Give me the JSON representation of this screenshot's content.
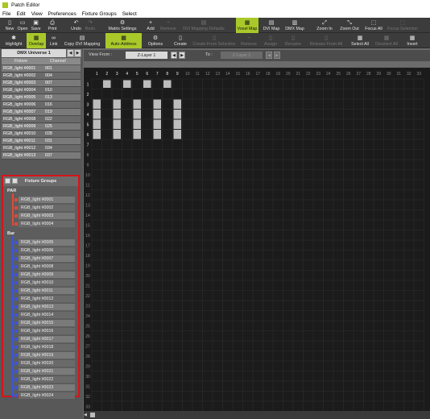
{
  "window": {
    "title": "Patch Editor"
  },
  "menu": [
    "File",
    "Edit",
    "View",
    "Preferences",
    "Fixture Groups",
    "Select"
  ],
  "toolbar1": [
    {
      "label": "New",
      "icon": "▯"
    },
    {
      "label": "Open",
      "icon": "▭"
    },
    {
      "label": "Save",
      "icon": "▣"
    },
    {
      "label": "Print",
      "icon": "⎙"
    },
    {
      "label": "Undo",
      "icon": "↶"
    },
    {
      "label": "Redo",
      "icon": "↷"
    },
    {
      "label": "Matrix Settings",
      "icon": "⚙"
    },
    {
      "label": "Add",
      "icon": "+"
    },
    {
      "label": "Remove",
      "icon": "−"
    },
    {
      "label": "DVI Mapping Defaults",
      "icon": "▤"
    },
    {
      "label": "Voxel Map",
      "icon": "▦"
    },
    {
      "label": "DVI Map",
      "icon": "▤"
    },
    {
      "label": "DMX Map",
      "icon": "▥"
    },
    {
      "label": "Zoom In",
      "icon": "⤢"
    },
    {
      "label": "Zoom Out",
      "icon": "⤡"
    },
    {
      "label": "Focus All",
      "icon": "⬚"
    },
    {
      "label": "Focus Selection",
      "icon": "⬚"
    }
  ],
  "toolbar2": [
    {
      "label": "Highlight",
      "icon": "✱"
    },
    {
      "label": "Overlap",
      "icon": "▦"
    },
    {
      "label": "Link",
      "icon": "∞"
    },
    {
      "label": "Copy DVI Mapping",
      "icon": "▤"
    },
    {
      "label": "Auto-Address",
      "icon": "▦"
    },
    {
      "label": "Options",
      "icon": "⚙"
    },
    {
      "label": "Create",
      "icon": "▯"
    },
    {
      "label": "Create From Selection",
      "icon": "▯"
    },
    {
      "label": "Remove",
      "icon": "−"
    },
    {
      "label": "Assign",
      "icon": "▯"
    },
    {
      "label": "Rename",
      "icon": "▯"
    },
    {
      "label": "Release From All",
      "icon": "▯"
    },
    {
      "label": "Select All",
      "icon": "▦"
    },
    {
      "label": "Deselect All",
      "icon": "▦"
    },
    {
      "label": "Invert",
      "icon": "▦"
    }
  ],
  "universe": {
    "label": "DMX Universe 1"
  },
  "patch_table": {
    "headers": [
      "Fixture",
      "Channel"
    ],
    "rows": [
      [
        "RGB_light #0001",
        "001"
      ],
      [
        "RGB_light #0002",
        "004"
      ],
      [
        "RGB_light #0003",
        "007"
      ],
      [
        "RGB_light #0004",
        "010"
      ],
      [
        "RGB_light #0005",
        "013"
      ],
      [
        "RGB_light #0006",
        "016"
      ],
      [
        "RGB_light #0007",
        "019"
      ],
      [
        "RGB_light #0008",
        "022"
      ],
      [
        "RGB_light #0009",
        "025"
      ],
      [
        "RGB_light #0010",
        "028"
      ],
      [
        "RGB_light #0011",
        "031"
      ],
      [
        "RGB_light #0012",
        "034"
      ],
      [
        "RGB_light #0013",
        "037"
      ]
    ]
  },
  "fixture_groups": {
    "header": "Fixture Groups",
    "groups": [
      {
        "name": "PAR",
        "color": "#e04a3a",
        "items": [
          "RGB_light #0001",
          "RGB_light #0002",
          "RGB_light #0003",
          "RGB_light #0004"
        ]
      },
      {
        "name": "Bar",
        "color": "#3a55e0",
        "items": [
          "RGB_light #0005",
          "RGB_light #0006",
          "RGB_light #0007",
          "RGB_light #0008",
          "RGB_light #0009",
          "RGB_light #0010",
          "RGB_light #0011",
          "RGB_light #0012",
          "RGB_light #0013",
          "RGB_light #0014",
          "RGB_light #0015",
          "RGB_light #0016",
          "RGB_light #0017",
          "RGB_light #0018",
          "RGB_light #0019",
          "RGB_light #0020",
          "RGB_light #0021",
          "RGB_light #0022",
          "RGB_light #0023",
          "RGB_light #0024"
        ]
      }
    ]
  },
  "view": {
    "from_label": "View From :",
    "from_value": "Z-Layer 1",
    "to_label": "To :",
    "to_value": "Z-Layer 1"
  },
  "grid": {
    "cols": 33,
    "rows": 33,
    "par_cells": [
      [
        2,
        1
      ],
      [
        4,
        1
      ],
      [
        6,
        1
      ],
      [
        8,
        1
      ]
    ],
    "bar_cols": [
      1,
      3,
      5,
      7,
      9
    ],
    "bar_rows": [
      3,
      4,
      5,
      6
    ]
  },
  "colors": {
    "accent": "#a9c92a",
    "highlight_box": "#d6141a"
  }
}
